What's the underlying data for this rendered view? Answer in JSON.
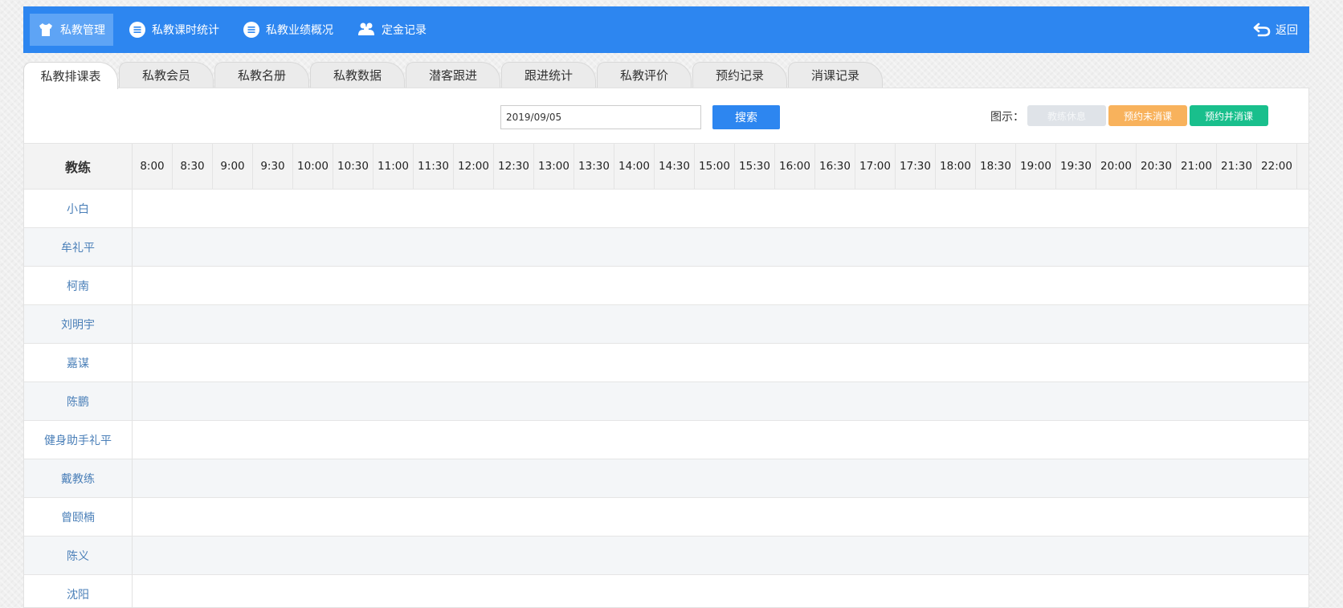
{
  "nav": {
    "items": [
      {
        "label": "私教管理",
        "icon": "shirt-icon",
        "active": true
      },
      {
        "label": "私教课时统计",
        "icon": "list-icon"
      },
      {
        "label": "私教业绩概况",
        "icon": "list-icon"
      },
      {
        "label": "定金记录",
        "icon": "users-icon"
      }
    ],
    "back_label": "返回"
  },
  "tabs": [
    "私教排课表",
    "私教会员",
    "私教名册",
    "私教数据",
    "潜客跟进",
    "跟进统计",
    "私教评价",
    "预约记录",
    "消课记录"
  ],
  "toolbar": {
    "date_value": "2019/09/05",
    "search_label": "搜索",
    "legend_label": "图示：",
    "legend": {
      "rest": "教练休息",
      "booked": "预约未消课",
      "done": "预约并消课"
    }
  },
  "colors": {
    "primary": "#2d86f0",
    "rest": "#dfe3e8",
    "booked": "#f8b25c",
    "done": "#19bf8c",
    "coach_link": "#4a7fb8"
  },
  "schedule": {
    "coach_header": "教练",
    "times": [
      "8:00",
      "8:30",
      "9:00",
      "9:30",
      "10:00",
      "10:30",
      "11:00",
      "11:30",
      "12:00",
      "12:30",
      "13:00",
      "13:30",
      "14:00",
      "14:30",
      "15:00",
      "15:30",
      "16:00",
      "16:30",
      "17:00",
      "17:30",
      "18:00",
      "18:30",
      "19:00",
      "19:30",
      "20:00",
      "20:30",
      "21:00",
      "21:30",
      "22:00"
    ],
    "coaches": [
      "小白",
      "牟礼平",
      "柯南",
      "刘明宇",
      "嘉谋",
      "陈鹏",
      "健身助手礼平",
      "戴教练",
      "曾颐楠",
      "陈义",
      "沈阳"
    ]
  }
}
